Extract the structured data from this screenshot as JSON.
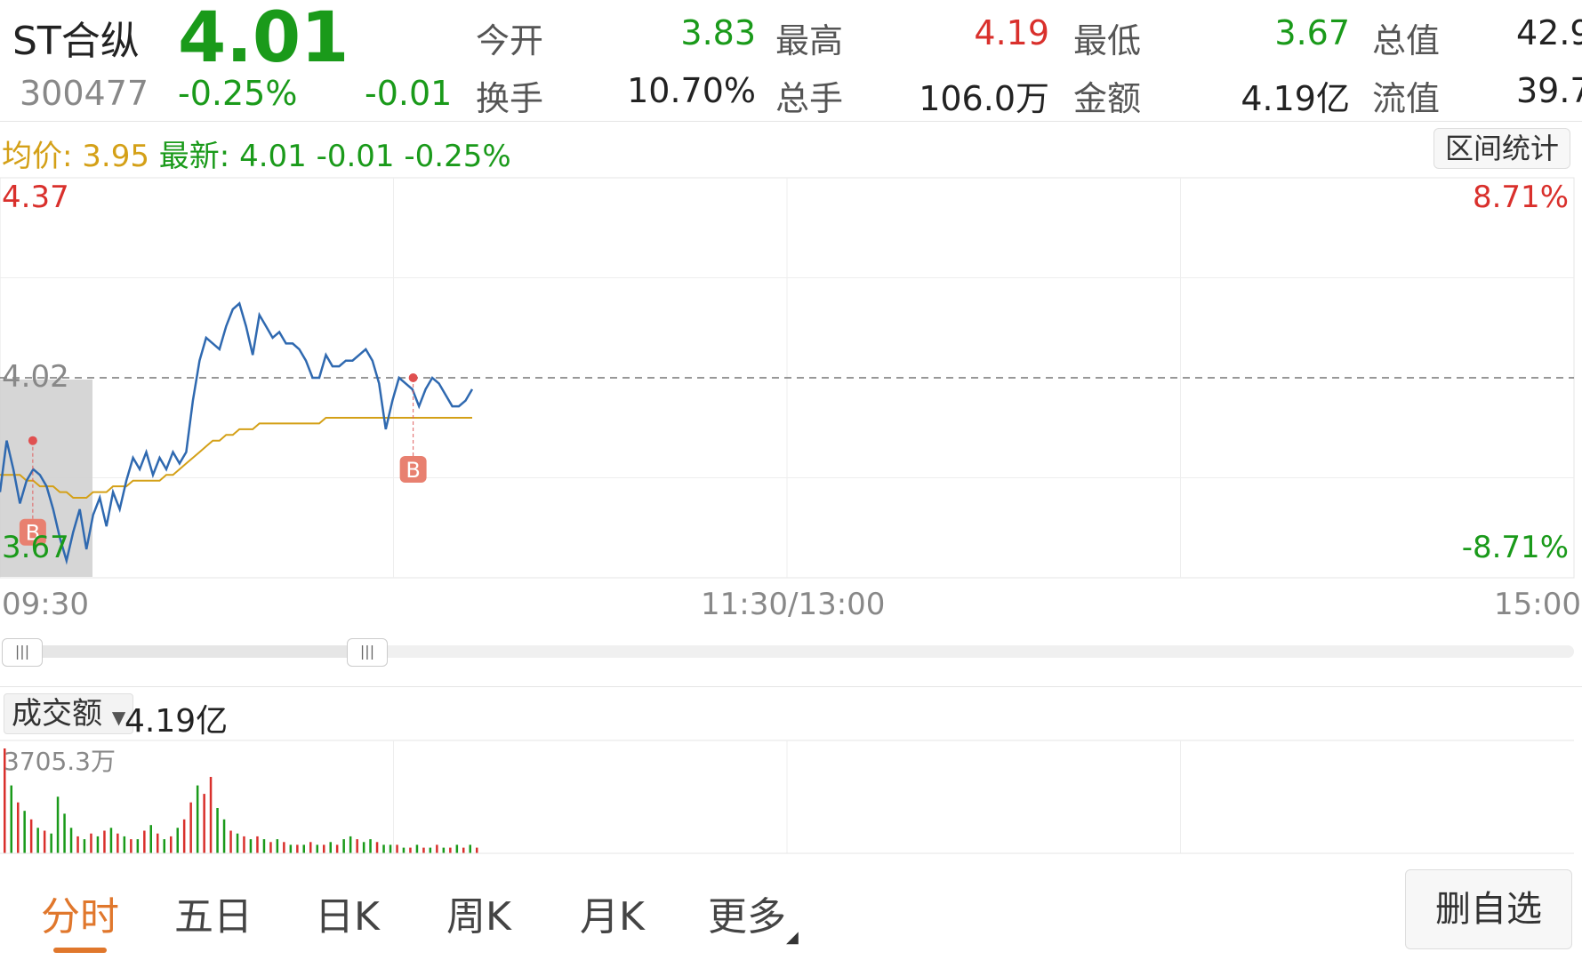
{
  "stock": {
    "name": "ST合纵",
    "code": "300477",
    "price": "4.01",
    "change_pct": "-0.25%",
    "change": "-0.01"
  },
  "stats": [
    {
      "label": "今开",
      "value": "3.83",
      "color": "green"
    },
    {
      "label": "最高",
      "value": "4.19",
      "color": "red"
    },
    {
      "label": "最低",
      "value": "3.67",
      "color": "green"
    },
    {
      "label": "总值",
      "value": "42.9",
      "color": "dark"
    },
    {
      "label": "换手",
      "value": "10.70%",
      "color": "dark"
    },
    {
      "label": "总手",
      "value": "106.0万",
      "color": "dark"
    },
    {
      "label": "金额",
      "value": "4.19亿",
      "color": "dark"
    },
    {
      "label": "流值",
      "value": "39.7",
      "color": "dark"
    }
  ],
  "info_bar": {
    "avg_label": "均价:",
    "avg_value": "3.95",
    "latest_label": "最新:",
    "latest_value": "4.01",
    "latest_change": "-0.01",
    "latest_pct": "-0.25%",
    "range_stats_button": "区间统计"
  },
  "chart_labels": {
    "y_top": "4.37",
    "y_mid": "4.02",
    "y_bottom": "3.67",
    "pct_top": "8.71%",
    "pct_bottom": "-8.71%",
    "x_start": "09:30",
    "x_mid": "11:30/13:00",
    "x_end": "15:00",
    "marker_label": "B"
  },
  "volume": {
    "selector_label": "成交额",
    "value": "4.19亿",
    "max_label": "3705.3万"
  },
  "tabs": [
    "分时",
    "五日",
    "日K",
    "周K",
    "月K",
    "更多"
  ],
  "delete_button": "删自选",
  "colors": {
    "up": "#d9302c",
    "down": "#1a9a1a",
    "price_line": "#2f69b0",
    "avg_line": "#d4a017",
    "accent": "#e0772c"
  },
  "chart_data": {
    "type": "line",
    "series": [
      {
        "values": [
          3.82,
          3.91,
          3.86,
          3.8,
          3.84,
          3.86,
          3.85,
          3.83,
          3.79,
          3.74,
          3.7,
          3.75,
          3.79,
          3.72,
          3.78,
          3.81,
          3.76,
          3.82,
          3.79,
          3.84,
          3.88,
          3.86,
          3.89,
          3.85,
          3.88,
          3.86,
          3.89,
          3.87,
          3.89,
          3.98,
          4.05,
          4.09,
          4.08,
          4.07,
          4.11,
          4.14,
          4.15,
          4.11,
          4.06,
          4.13,
          4.11,
          4.09,
          4.1,
          4.08,
          4.08,
          4.07,
          4.05,
          4.02,
          4.02,
          4.06,
          4.04,
          4.04,
          4.05,
          4.05,
          4.06,
          4.07,
          4.05,
          4.01,
          3.93,
          3.98,
          4.02,
          4.01,
          4.0,
          3.97,
          4.0,
          4.02,
          4.01,
          3.99,
          3.97,
          3.97,
          3.98,
          4.0
        ]
      },
      {
        "values": [
          3.85,
          3.85,
          3.85,
          3.85,
          3.84,
          3.84,
          3.83,
          3.83,
          3.83,
          3.82,
          3.82,
          3.81,
          3.81,
          3.81,
          3.82,
          3.82,
          3.82,
          3.83,
          3.83,
          3.83,
          3.84,
          3.84,
          3.84,
          3.84,
          3.84,
          3.85,
          3.85,
          3.86,
          3.87,
          3.88,
          3.89,
          3.9,
          3.91,
          3.91,
          3.92,
          3.92,
          3.93,
          3.93,
          3.93,
          3.94,
          3.94,
          3.94,
          3.94,
          3.94,
          3.94,
          3.94,
          3.94,
          3.94,
          3.94,
          3.95,
          3.95,
          3.95,
          3.95,
          3.95,
          3.95,
          3.95,
          3.95,
          3.95,
          3.95,
          3.95,
          3.95,
          3.95,
          3.95,
          3.95,
          3.95,
          3.95,
          3.95,
          3.95,
          3.95,
          3.95,
          3.95,
          3.95
        ]
      }
    ],
    "ylim": [
      3.67,
      4.37
    ],
    "reference": 4.02,
    "total_minutes": 240,
    "minutes_elapsed": 72,
    "buy_markers": [
      {
        "minute": 5,
        "price": 3.91
      },
      {
        "minute": 63,
        "price": 4.02
      }
    ],
    "volume_bars": [
      {
        "v": 3705,
        "up": true
      },
      {
        "v": 2400,
        "up": false
      },
      {
        "v": 1800,
        "up": true
      },
      {
        "v": 1500,
        "up": false
      },
      {
        "v": 1200,
        "up": true
      },
      {
        "v": 900,
        "up": false
      },
      {
        "v": 800,
        "up": true
      },
      {
        "v": 700,
        "up": false
      },
      {
        "v": 2000,
        "up": false
      },
      {
        "v": 1400,
        "up": false
      },
      {
        "v": 900,
        "up": false
      },
      {
        "v": 600,
        "up": true
      },
      {
        "v": 500,
        "up": false
      },
      {
        "v": 700,
        "up": true
      },
      {
        "v": 600,
        "up": false
      },
      {
        "v": 800,
        "up": true
      },
      {
        "v": 900,
        "up": false
      },
      {
        "v": 700,
        "up": true
      },
      {
        "v": 600,
        "up": false
      },
      {
        "v": 500,
        "up": true
      },
      {
        "v": 500,
        "up": false
      },
      {
        "v": 800,
        "up": true
      },
      {
        "v": 1000,
        "up": false
      },
      {
        "v": 700,
        "up": true
      },
      {
        "v": 500,
        "up": false
      },
      {
        "v": 600,
        "up": true
      },
      {
        "v": 900,
        "up": false
      },
      {
        "v": 1200,
        "up": true
      },
      {
        "v": 1800,
        "up": true
      },
      {
        "v": 2400,
        "up": false
      },
      {
        "v": 2100,
        "up": true
      },
      {
        "v": 2700,
        "up": true
      },
      {
        "v": 1600,
        "up": false
      },
      {
        "v": 1200,
        "up": false
      },
      {
        "v": 800,
        "up": true
      },
      {
        "v": 700,
        "up": false
      },
      {
        "v": 600,
        "up": true
      },
      {
        "v": 500,
        "up": false
      },
      {
        "v": 600,
        "up": true
      },
      {
        "v": 500,
        "up": false
      },
      {
        "v": 400,
        "up": true
      },
      {
        "v": 500,
        "up": false
      },
      {
        "v": 400,
        "up": true
      },
      {
        "v": 300,
        "up": false
      },
      {
        "v": 300,
        "up": true
      },
      {
        "v": 300,
        "up": false
      },
      {
        "v": 400,
        "up": true
      },
      {
        "v": 300,
        "up": false
      },
      {
        "v": 300,
        "up": true
      },
      {
        "v": 400,
        "up": false
      },
      {
        "v": 300,
        "up": true
      },
      {
        "v": 500,
        "up": false
      },
      {
        "v": 600,
        "up": false
      },
      {
        "v": 500,
        "up": true
      },
      {
        "v": 400,
        "up": false
      },
      {
        "v": 500,
        "up": false
      },
      {
        "v": 400,
        "up": true
      },
      {
        "v": 300,
        "up": false
      },
      {
        "v": 300,
        "up": false
      },
      {
        "v": 300,
        "up": true
      },
      {
        "v": 200,
        "up": false
      },
      {
        "v": 200,
        "up": true
      },
      {
        "v": 300,
        "up": false
      },
      {
        "v": 200,
        "up": true
      },
      {
        "v": 200,
        "up": false
      },
      {
        "v": 300,
        "up": true
      },
      {
        "v": 200,
        "up": false
      },
      {
        "v": 200,
        "up": true
      },
      {
        "v": 300,
        "up": false
      },
      {
        "v": 200,
        "up": true
      },
      {
        "v": 300,
        "up": false
      },
      {
        "v": 200,
        "up": true
      }
    ]
  }
}
